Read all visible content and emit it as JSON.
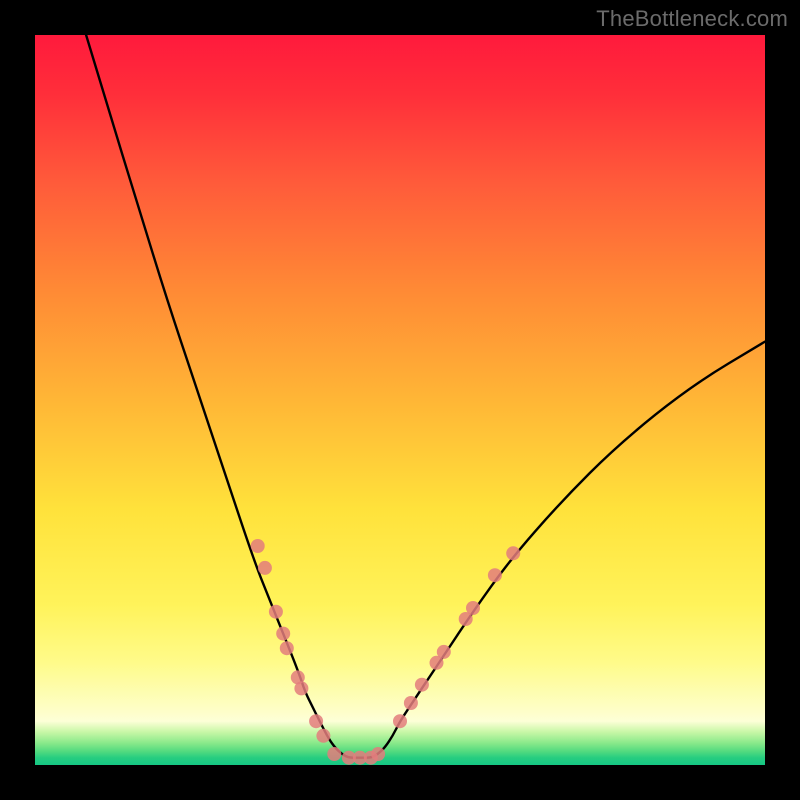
{
  "watermark": "TheBottleneck.com",
  "chart_data": {
    "type": "line",
    "title": "",
    "xlabel": "",
    "ylabel": "",
    "xlim": [
      0,
      100
    ],
    "ylim": [
      0,
      100
    ],
    "grid": false,
    "series": [
      {
        "name": "bottleneck-curve",
        "color": "#000000",
        "x": [
          7,
          10,
          14,
          18,
          22,
          26,
          30,
          32,
          34,
          36,
          37,
          38,
          39,
          40,
          41,
          42,
          43,
          44,
          45,
          46,
          47,
          48,
          49,
          50,
          52,
          54,
          56,
          60,
          65,
          72,
          80,
          90,
          100
        ],
        "y": [
          100,
          90,
          77,
          64,
          52,
          40,
          28,
          23,
          18,
          13,
          10,
          8,
          6,
          4,
          2.5,
          1.5,
          1,
          1,
          1,
          1,
          1.5,
          2.5,
          4,
          6,
          9,
          12,
          15,
          21,
          28,
          36,
          44,
          52,
          58
        ]
      }
    ],
    "markers": {
      "name": "sample-points",
      "color": "#e37d7d",
      "radius_px": 7,
      "points": [
        {
          "x": 30.5,
          "y": 30
        },
        {
          "x": 31.5,
          "y": 27
        },
        {
          "x": 33.0,
          "y": 21
        },
        {
          "x": 34.0,
          "y": 18
        },
        {
          "x": 34.5,
          "y": 16
        },
        {
          "x": 36.0,
          "y": 12
        },
        {
          "x": 36.5,
          "y": 10.5
        },
        {
          "x": 38.5,
          "y": 6
        },
        {
          "x": 39.5,
          "y": 4
        },
        {
          "x": 41.0,
          "y": 1.5
        },
        {
          "x": 43.0,
          "y": 1
        },
        {
          "x": 44.5,
          "y": 1
        },
        {
          "x": 46.0,
          "y": 1
        },
        {
          "x": 47.0,
          "y": 1.5
        },
        {
          "x": 50.0,
          "y": 6
        },
        {
          "x": 51.5,
          "y": 8.5
        },
        {
          "x": 53.0,
          "y": 11
        },
        {
          "x": 55.0,
          "y": 14
        },
        {
          "x": 56.0,
          "y": 15.5
        },
        {
          "x": 59.0,
          "y": 20
        },
        {
          "x": 60.0,
          "y": 21.5
        },
        {
          "x": 63.0,
          "y": 26
        },
        {
          "x": 65.5,
          "y": 29
        }
      ]
    }
  }
}
